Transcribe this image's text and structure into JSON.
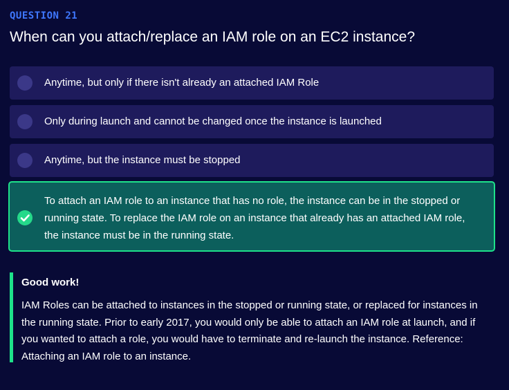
{
  "question": {
    "number_label": "QUESTION 21",
    "text": "When can you attach/replace an IAM role on an EC2 instance?"
  },
  "options": [
    {
      "label": "Anytime, but only if there isn't already an attached IAM Role",
      "state": "unselected"
    },
    {
      "label": "Only during launch and cannot be changed once the instance is launched",
      "state": "unselected"
    },
    {
      "label": "Anytime, but the instance must be stopped",
      "state": "unselected"
    },
    {
      "label": "To attach an IAM role to an instance that has no role, the instance can be in the stopped or running state. To replace the IAM role on an instance that already has an attached IAM role, the instance must be in the running state.",
      "state": "correct",
      "icon": "check-circle-icon"
    }
  ],
  "feedback": {
    "title": "Good work!",
    "body": "IAM Roles can be attached to instances in the stopped or running state, or replaced for instances in the running state. Prior to early 2017, you would only be able to attach an IAM role at launch, and if you wanted to attach a role, you would have to terminate and re-launch the instance. Reference: Attaching an IAM role to an instance."
  },
  "colors": {
    "background": "#080a36",
    "accent_blue": "#3f78ff",
    "option_bg": "#1e1b5c",
    "radio": "#3b3888",
    "correct_bg": "#0c5f5c",
    "correct_border": "#1ee28a"
  }
}
